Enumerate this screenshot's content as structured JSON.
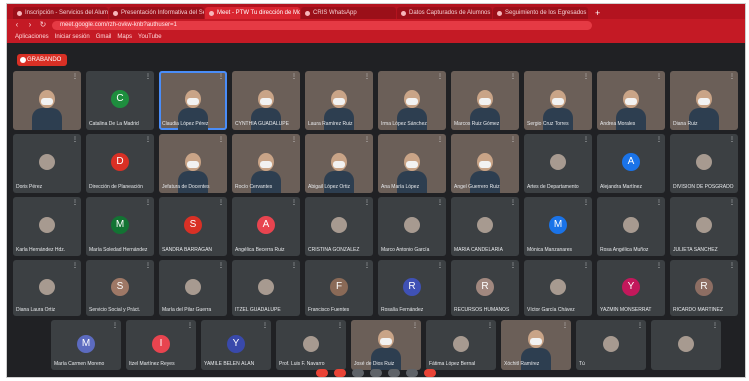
{
  "browser": {
    "tabs": [
      {
        "title": "Inscripción - Servicios del Alumno",
        "active": false
      },
      {
        "title": "Presentación Informativa del Sem...",
        "active": false
      },
      {
        "title": "Meet - PTW Tu dirección de Mo...",
        "active": true
      },
      {
        "title": "CRIS WhatsApp",
        "active": false
      },
      {
        "title": "Datos Capturados de Alumnos",
        "active": false
      },
      {
        "title": "Seguimiento de los Egresados",
        "active": false
      }
    ],
    "new_tab": "+",
    "url": "meet.google.com/rzh-ovkw-knb?authuser=1",
    "bookmarks": [
      "Aplicaciones",
      "Iniciar sesión",
      "Gmail",
      "Maps",
      "YouTube"
    ]
  },
  "meeting": {
    "recording_label": "GRABANDO",
    "participants": [
      {
        "name": "",
        "kind": "video"
      },
      {
        "name": "Catalina De La Madrid",
        "kind": "avatar",
        "initial": "C",
        "color": "#1e8e3e"
      },
      {
        "name": "Claudia López Pérez",
        "kind": "video",
        "highlight": true
      },
      {
        "name": "CYNTHIA GUADALUPE",
        "kind": "video"
      },
      {
        "name": "Laura Ramírez Ruiz",
        "kind": "video"
      },
      {
        "name": "Irma López Sánchez",
        "kind": "video"
      },
      {
        "name": "Marcos Ruiz Gómez",
        "kind": "video"
      },
      {
        "name": "Sergio Cruz Torres",
        "kind": "video"
      },
      {
        "name": "Andrea Morales",
        "kind": "video"
      },
      {
        "name": "Diana Ruiz",
        "kind": "video"
      },
      {
        "name": "Doris Pérez",
        "kind": "photo"
      },
      {
        "name": "Dirección de Planeación",
        "kind": "avatar",
        "initial": "D",
        "color": "#d93025"
      },
      {
        "name": "Jefatura de Docentes",
        "kind": "video"
      },
      {
        "name": "Rocío Cervantes",
        "kind": "video"
      },
      {
        "name": "Abigail López Ortiz",
        "kind": "video"
      },
      {
        "name": "Ana María López",
        "kind": "video"
      },
      {
        "name": "Ángel Guerrero Ruiz",
        "kind": "video"
      },
      {
        "name": "Artes de Departamento",
        "kind": "photo"
      },
      {
        "name": "Alejandra Martínez",
        "kind": "avatar",
        "initial": "A",
        "color": "#1a73e8"
      },
      {
        "name": "DIVISIÓN DE POSGRADO",
        "kind": "photo"
      },
      {
        "name": "Karla Hernández Hdz.",
        "kind": "photo"
      },
      {
        "name": "María Soledad Hernández",
        "kind": "avatar",
        "initial": "M",
        "color": "#137333"
      },
      {
        "name": "SANDRA BARRAGÁN",
        "kind": "avatar",
        "initial": "S",
        "color": "#d93025"
      },
      {
        "name": "Angélica Becerra Ruiz",
        "kind": "avatar",
        "initial": "A",
        "color": "#e8444f"
      },
      {
        "name": "CRISTINA GONZÁLEZ",
        "kind": "photo"
      },
      {
        "name": "Marco Antonio García",
        "kind": "photo"
      },
      {
        "name": "MARÍA CANDELARIA",
        "kind": "photo"
      },
      {
        "name": "Mónica Manzanares",
        "kind": "avatar",
        "initial": "M",
        "color": "#1a73e8"
      },
      {
        "name": "Rosa Angélica Muñoz",
        "kind": "photo"
      },
      {
        "name": "JULIETA SÁNCHEZ",
        "kind": "photo"
      },
      {
        "name": "Diana Laura Ortiz",
        "kind": "photo"
      },
      {
        "name": "Servicio Social y Práct.",
        "kind": "avatar",
        "initial": "S",
        "color": "#9e7866"
      },
      {
        "name": "María del Pilar Guerra",
        "kind": "photo"
      },
      {
        "name": "ITZEL GUADALUPE",
        "kind": "photo"
      },
      {
        "name": "Francisco Fuentes",
        "kind": "avatar",
        "initial": "F",
        "color": "#8a6a57"
      },
      {
        "name": "Rosalía Fernández",
        "kind": "avatar",
        "initial": "R",
        "color": "#3f51b5"
      },
      {
        "name": "RECURSOS HUMANOS",
        "kind": "avatar",
        "initial": "R",
        "color": "#a1887f"
      },
      {
        "name": "Víctor García Chávez",
        "kind": "photo"
      },
      {
        "name": "YAZMIN MONSERRAT",
        "kind": "avatar",
        "initial": "Y",
        "color": "#c2185b"
      },
      {
        "name": "RICARDO MARTÍNEZ",
        "kind": "avatar",
        "initial": "R",
        "color": "#8d6e63"
      },
      {
        "name": "María Carmen Moreno",
        "kind": "avatar",
        "initial": "M",
        "color": "#5c6bc0"
      },
      {
        "name": "Itzel Martínez Reyes",
        "kind": "avatar",
        "initial": "I",
        "color": "#e8444f"
      },
      {
        "name": "YAMILE BELÉN ÁLAN",
        "kind": "avatar",
        "initial": "Y",
        "color": "#3949ab"
      },
      {
        "name": "Prof. Luis F. Navarro",
        "kind": "photo"
      },
      {
        "name": "José de Dios Ruiz",
        "kind": "video"
      },
      {
        "name": "Fátima López Bernal",
        "kind": "photo"
      },
      {
        "name": "Xóchitl Ramírez",
        "kind": "video"
      },
      {
        "name": "Tú",
        "kind": "photo"
      },
      {
        "name": "",
        "kind": "photo"
      }
    ]
  },
  "controls": [
    {
      "name": "mic-toggle-button",
      "color": "red"
    },
    {
      "name": "camera-toggle-button",
      "color": "red"
    },
    {
      "name": "captions-button",
      "color": "grey"
    },
    {
      "name": "present-button",
      "color": "grey"
    },
    {
      "name": "raise-hand-button",
      "color": "grey"
    },
    {
      "name": "more-options-button",
      "color": "grey"
    },
    {
      "name": "leave-call-button",
      "color": "red"
    }
  ]
}
